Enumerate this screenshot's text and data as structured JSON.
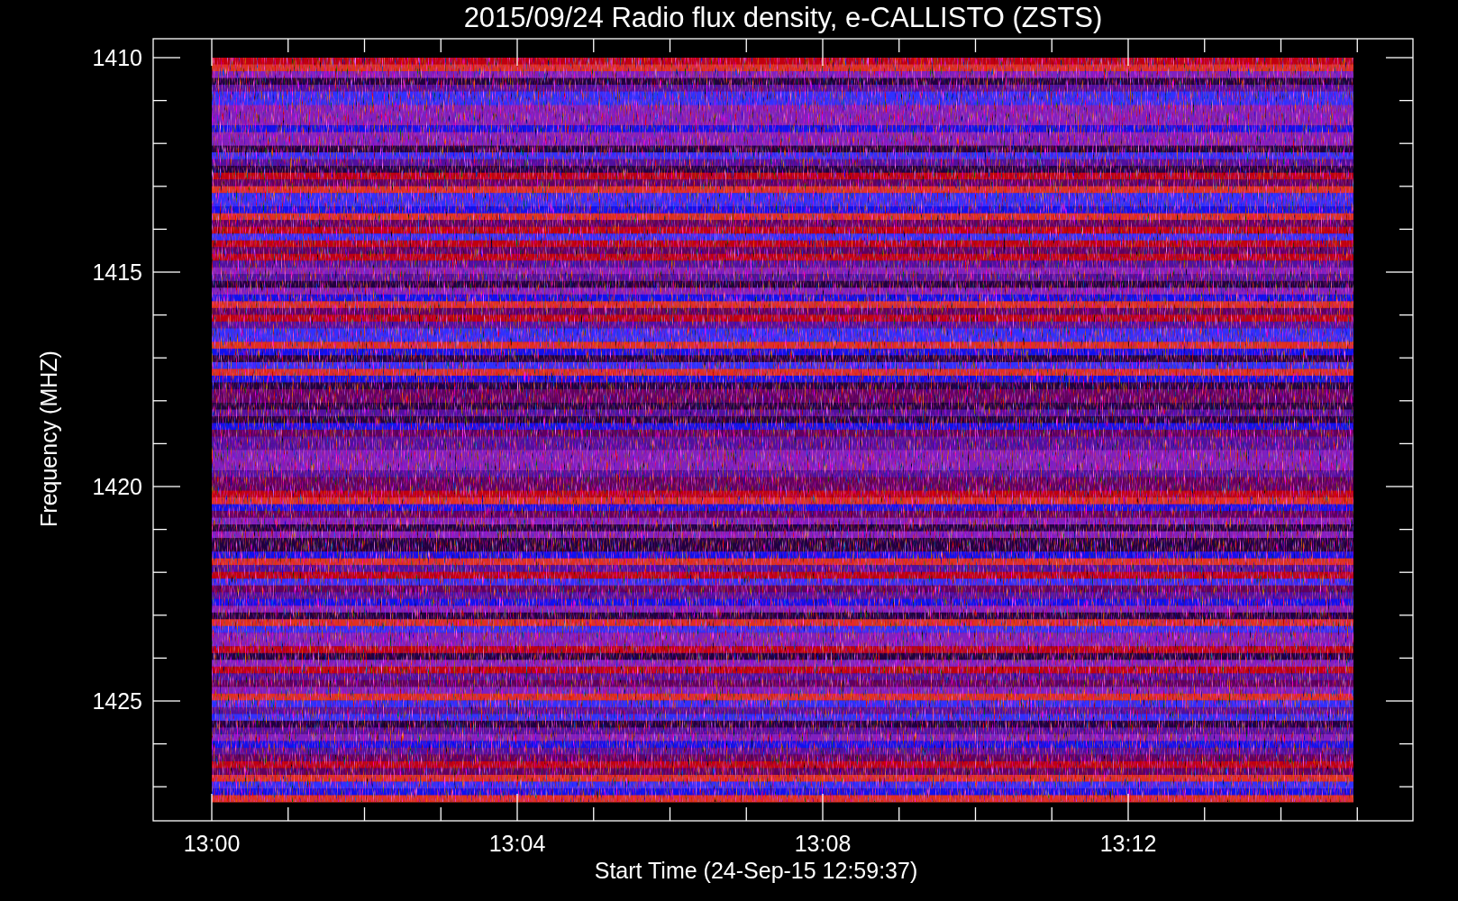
{
  "title": "2015/09/24  Radio flux density, e-CALLISTO (ZSTS)",
  "plot": {
    "ylabel": "Frequency (MHZ)",
    "xlabel": "Start Time (24-Sep-15 12:59:37)",
    "yticks": [
      "1410",
      "1415",
      "1420",
      "1425"
    ],
    "xticks": [
      "13:00",
      "13:04",
      "13:08",
      "13:12"
    ]
  }
}
